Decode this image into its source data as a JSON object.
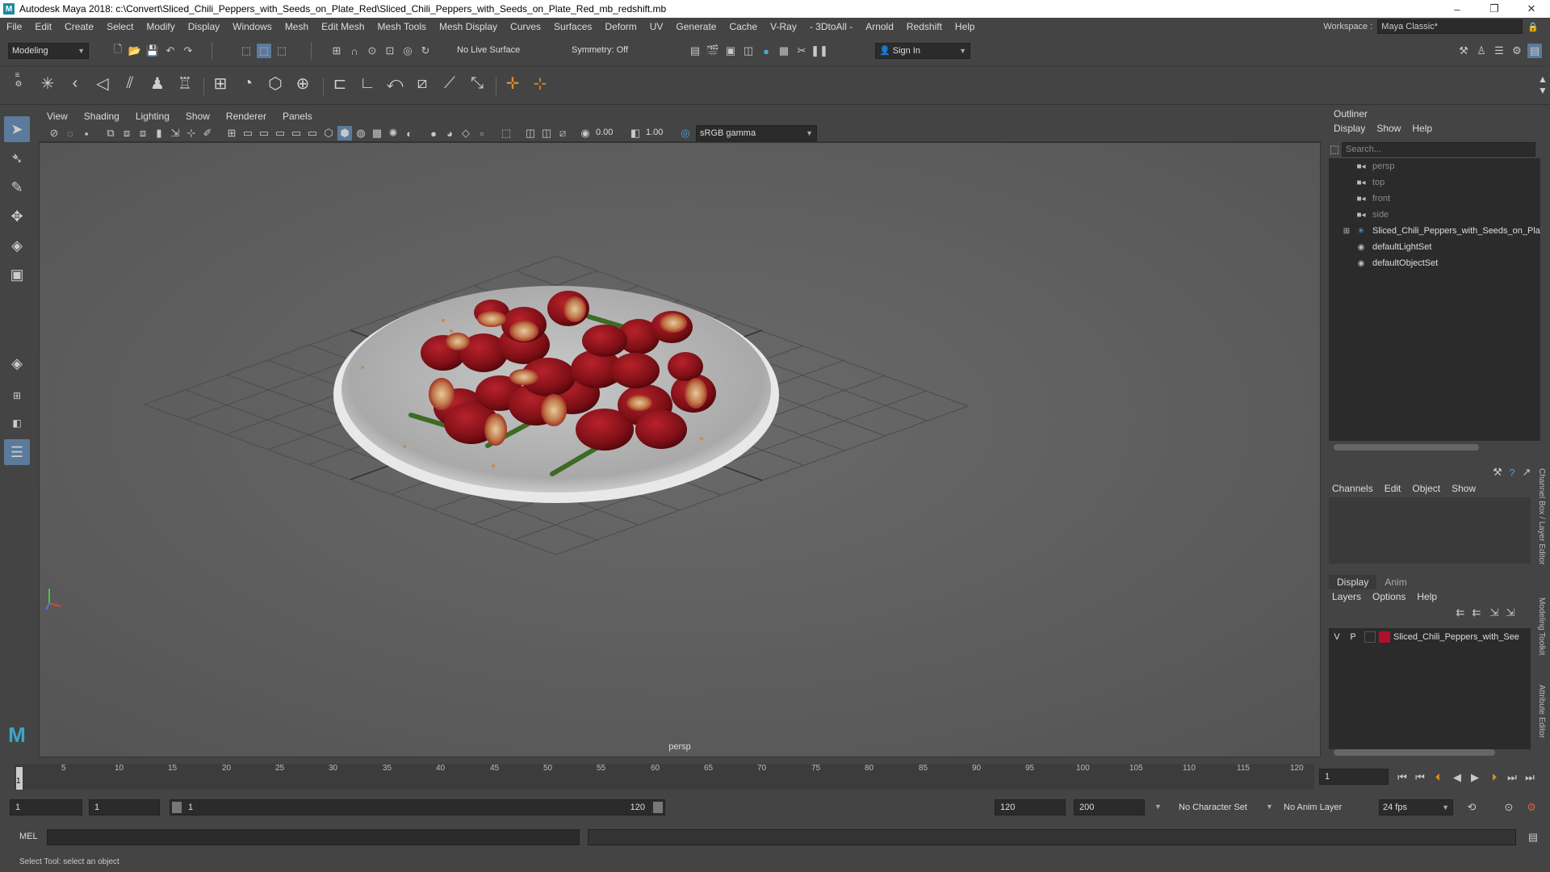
{
  "titlebar": {
    "title": "Autodesk Maya 2018: c:\\Convert\\Sliced_Chili_Peppers_with_Seeds_on_Plate_Red\\Sliced_Chili_Peppers_with_Seeds_on_Plate_Red_mb_redshift.mb",
    "minimize": "–",
    "maximize": "❐",
    "close": "✕"
  },
  "menubar": {
    "items": [
      "File",
      "Edit",
      "Create",
      "Select",
      "Modify",
      "Display",
      "Windows",
      "Mesh",
      "Edit Mesh",
      "Mesh Tools",
      "Mesh Display",
      "Curves",
      "Surfaces",
      "Deform",
      "UV",
      "Generate",
      "Cache",
      "V-Ray",
      "- 3DtoAll -",
      "Arnold",
      "Redshift",
      "Help"
    ],
    "workspace_label": "Workspace :",
    "workspace_value": "Maya Classic*"
  },
  "statusline": {
    "mode": "Modeling",
    "live_surface": "No Live Surface",
    "symmetry": "Symmetry: Off",
    "sign_in": "Sign In"
  },
  "viewport": {
    "menu": [
      "View",
      "Shading",
      "Lighting",
      "Show",
      "Renderer",
      "Panels"
    ],
    "exposure": "0.00",
    "gamma": "1.00",
    "color_space": "sRGB gamma",
    "camera_label": "persp"
  },
  "outliner": {
    "title": "Outliner",
    "menu": [
      "Display",
      "Show",
      "Help"
    ],
    "search_placeholder": "Search...",
    "items": [
      {
        "label": "persp",
        "icon": "camera-icon",
        "dim": true
      },
      {
        "label": "top",
        "icon": "camera-icon",
        "dim": true
      },
      {
        "label": "front",
        "icon": "camera-icon",
        "dim": true
      },
      {
        "label": "side",
        "icon": "camera-icon",
        "dim": true
      },
      {
        "label": "Sliced_Chili_Peppers_with_Seeds_on_Pla",
        "icon": "group-icon",
        "dim": false
      },
      {
        "label": "defaultLightSet",
        "icon": "set-icon",
        "dim": false
      },
      {
        "label": "defaultObjectSet",
        "icon": "set-icon",
        "dim": false
      }
    ]
  },
  "channelbox": {
    "menu": [
      "Channels",
      "Edit",
      "Object",
      "Show"
    ]
  },
  "layers": {
    "tabs": [
      "Display",
      "Anim"
    ],
    "menu": [
      "Layers",
      "Options",
      "Help"
    ],
    "row": {
      "v": "V",
      "p": "P",
      "name": "Sliced_Chili_Peppers_with_See",
      "color": "#b0102a"
    }
  },
  "sidetabs": [
    "Channel Box / Layer Editor",
    "Modeling Toolkit",
    "Attribute Editor"
  ],
  "timeline": {
    "ticks": [
      "5",
      "10",
      "15",
      "20",
      "25",
      "30",
      "35",
      "40",
      "45",
      "50",
      "55",
      "60",
      "65",
      "70",
      "75",
      "80",
      "85",
      "90",
      "95",
      "100",
      "105",
      "110",
      "115",
      "120"
    ],
    "current_marker": "1",
    "current_frame": "1"
  },
  "range": {
    "start": "1",
    "inner_start": "1",
    "slider_start": "1",
    "slider_end": "120",
    "end": "120",
    "max_end": "200",
    "character_set": "No Character Set",
    "anim_layer": "No Anim Layer",
    "fps": "24 fps"
  },
  "cmdline": {
    "label": "MEL"
  },
  "helpline": {
    "text": "Select Tool: select an object"
  }
}
